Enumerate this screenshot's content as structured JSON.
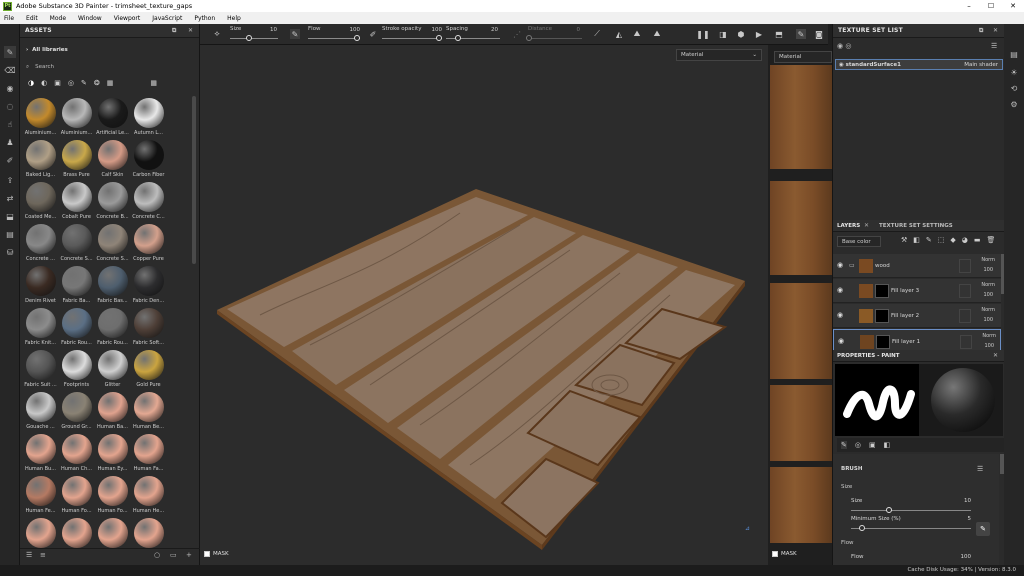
{
  "window": {
    "title": "Adobe Substance 3D Painter - trimsheet_texture_gaps",
    "logo": "Pt"
  },
  "menu": [
    "File",
    "Edit",
    "Mode",
    "Window",
    "Viewport",
    "JavaScript",
    "Python",
    "Help"
  ],
  "assets": {
    "title": "ASSETS",
    "library": "All libraries",
    "search_placeholder": "Search",
    "materials": [
      {
        "name": "Aluminium...",
        "color": "#c38a2c"
      },
      {
        "name": "Aluminium...",
        "color": "#b8b8b8"
      },
      {
        "name": "Artificial Le...",
        "color": "#1a1a1a"
      },
      {
        "name": "Autumn L...",
        "color": "#e8e8e8"
      },
      {
        "name": "Baked Lig...",
        "color": "#b09f86"
      },
      {
        "name": "Brass Pure",
        "color": "#c9a84a"
      },
      {
        "name": "Calf Skin",
        "color": "#d49a86"
      },
      {
        "name": "Carbon Fiber",
        "color": "#111111"
      },
      {
        "name": "Coated Me...",
        "color": "#6e675c"
      },
      {
        "name": "Cobalt Pure",
        "color": "#c9c9c9"
      },
      {
        "name": "Concrete B...",
        "color": "#9a9a9a"
      },
      {
        "name": "Concrete C...",
        "color": "#bdbdbd"
      },
      {
        "name": "Concrete ...",
        "color": "#888888"
      },
      {
        "name": "Concrete S...",
        "color": "#5a5a5a"
      },
      {
        "name": "Concrete S...",
        "color": "#8f8478"
      },
      {
        "name": "Copper Pure",
        "color": "#d3a08c"
      },
      {
        "name": "Denim Rivet",
        "color": "#3a2a22"
      },
      {
        "name": "Fabric Ba...",
        "color": "#777777"
      },
      {
        "name": "Fabric Bas...",
        "color": "#4e5e6e"
      },
      {
        "name": "Fabric Den...",
        "color": "#2c2c2e"
      },
      {
        "name": "Fabric Knit...",
        "color": "#8c8c8c"
      },
      {
        "name": "Fabric Rou...",
        "color": "#5b6f85"
      },
      {
        "name": "Fabric Rou...",
        "color": "#6e6e6e"
      },
      {
        "name": "Fabric Soft...",
        "color": "#4e3f37"
      },
      {
        "name": "Fabric Suit ...",
        "color": "#555555"
      },
      {
        "name": "Footprints",
        "color": "#dcdcdc"
      },
      {
        "name": "Glitter",
        "color": "#cfcfcf"
      },
      {
        "name": "Gold Pure",
        "color": "#caa440"
      },
      {
        "name": "Gouache ...",
        "color": "#c8c8c8"
      },
      {
        "name": "Ground Gr...",
        "color": "#8a8274"
      },
      {
        "name": "Human Ba...",
        "color": "#e0a28e"
      },
      {
        "name": "Human Be...",
        "color": "#e3a892"
      },
      {
        "name": "Human Bu...",
        "color": "#e3a48e"
      },
      {
        "name": "Human Ch...",
        "color": "#e3a48e"
      },
      {
        "name": "Human Ey...",
        "color": "#e3a48e"
      },
      {
        "name": "Human Fa...",
        "color": "#e3a48e"
      },
      {
        "name": "Human Fe...",
        "color": "#b57a63"
      },
      {
        "name": "Human Fo...",
        "color": "#e3a48e"
      },
      {
        "name": "Human Fo...",
        "color": "#e3a48e"
      },
      {
        "name": "Human He...",
        "color": "#e3a48e"
      },
      {
        "name": "",
        "color": "#e3a48e"
      },
      {
        "name": "",
        "color": "#e3a48e"
      },
      {
        "name": "",
        "color": "#e3a48e"
      },
      {
        "name": "",
        "color": "#e3a48e"
      }
    ]
  },
  "toolbar": {
    "size_label": "Size",
    "size_value": "10",
    "flow_label": "Flow",
    "flow_value": "100",
    "stroke_label": "Stroke opacity",
    "stroke_value": "100",
    "spacing_label": "Spacing",
    "spacing_value": "20",
    "distance_label": "Distance",
    "distance_value": "0"
  },
  "viewport": {
    "material_dropdown": "Material",
    "mask_label": "MASK"
  },
  "view2d": {
    "material_dropdown": "Material",
    "mask_label": "MASK"
  },
  "texture_set_list": {
    "title": "TEXTURE SET LIST",
    "item": "standardSurface1",
    "shader": "Main shader"
  },
  "layers": {
    "tab_layers": "LAYERS",
    "tab_settings": "TEXTURE SET SETTINGS",
    "channel": "Base color",
    "rows": [
      {
        "name": "wood",
        "blend": "Norm",
        "opacity": "100"
      },
      {
        "name": "Fill layer 3",
        "blend": "Norm",
        "opacity": "100"
      },
      {
        "name": "Fill layer 2",
        "blend": "Norm",
        "opacity": "100"
      },
      {
        "name": "Fill layer 1",
        "blend": "Norm",
        "opacity": "100"
      }
    ]
  },
  "properties": {
    "title": "PROPERTIES - PAINT",
    "section": "BRUSH",
    "size_group": "Size",
    "size_label": "Size",
    "size_value": "10",
    "min_size_label": "Minimum Size (%)",
    "min_size_value": "5",
    "flow_group": "Flow",
    "flow_label": "Flow",
    "flow_value": "100"
  },
  "status": {
    "text": "Cache Disk Usage:  34% | Version: 8.3.0"
  }
}
